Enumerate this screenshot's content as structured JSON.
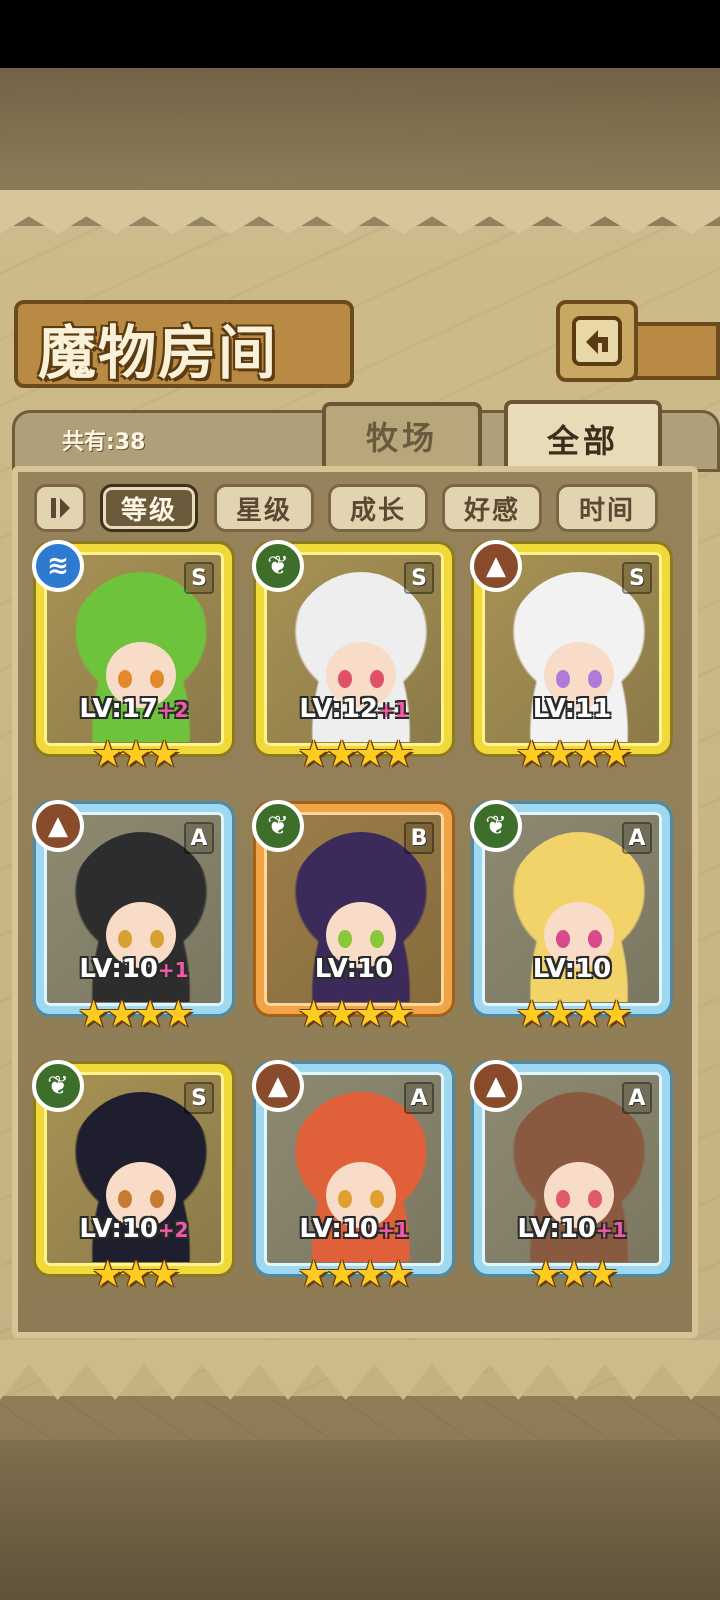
{
  "header": {
    "title": "魔物房间",
    "count_text": "共有:38"
  },
  "tabs": {
    "ranch": "牧场",
    "all": "全部",
    "active": "all"
  },
  "sort": {
    "options": [
      "等级",
      "星级",
      "成长",
      "好感",
      "时间"
    ],
    "active": "等级"
  },
  "icons": {
    "back": "back-arrow-icon",
    "order": "sort-order-icon",
    "elements": [
      "water-element-icon",
      "grass-element-icon",
      "earth-element-icon"
    ]
  },
  "colors": {
    "grade_S": "#f1d93a",
    "grade_A": "#9fd8ef",
    "grade_B": "#f0a447",
    "bonus": "#f25aa8",
    "star": "#ffcc22"
  },
  "monsters": [
    {
      "grade": "S",
      "element": "water",
      "level": "LV:17",
      "bonus": "+2",
      "stars": "★★★"
    },
    {
      "grade": "S",
      "element": "grass",
      "level": "LV:12",
      "bonus": "+1",
      "stars": "★★★★"
    },
    {
      "grade": "S",
      "element": "earth",
      "level": "LV:11",
      "bonus": "",
      "stars": "★★★★"
    },
    {
      "grade": "A",
      "element": "earth",
      "level": "LV:10",
      "bonus": "+1",
      "stars": "★★★★"
    },
    {
      "grade": "B",
      "element": "grass",
      "level": "LV:10",
      "bonus": "",
      "stars": "★★★★"
    },
    {
      "grade": "A",
      "element": "grass",
      "level": "LV:10",
      "bonus": "",
      "stars": "★★★★"
    },
    {
      "grade": "S",
      "element": "grass",
      "level": "LV:10",
      "bonus": "+2",
      "stars": "★★★"
    },
    {
      "grade": "A",
      "element": "earth",
      "level": "LV:10",
      "bonus": "+1",
      "stars": "★★★★"
    },
    {
      "grade": "A",
      "element": "earth",
      "level": "LV:10",
      "bonus": "+1",
      "stars": "★★★"
    }
  ]
}
